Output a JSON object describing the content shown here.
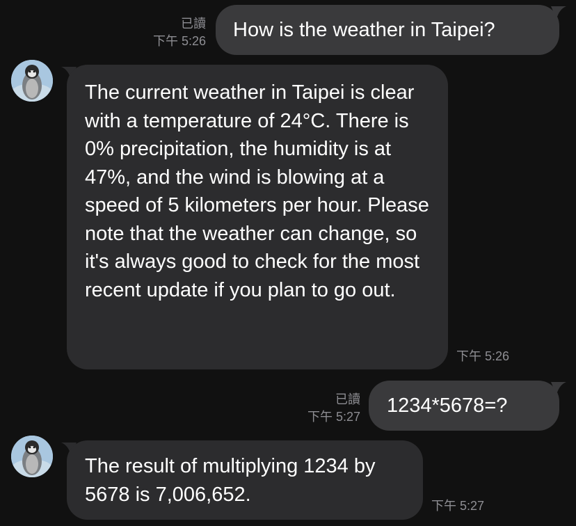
{
  "messages": [
    {
      "direction": "outgoing",
      "text": "How is the weather in Taipei?",
      "read_status": "已讀",
      "time": "下午 5:26"
    },
    {
      "direction": "incoming",
      "text": "The current weather in Taipei is clear with a temperature of 24°C. There is 0% precipitation, the humidity is at 47%, and the wind is blowing at a speed of 5 kilometers per hour. Please note that the weather can change, so it's always good to check for the most recent update if you plan to go out.",
      "time": "下午 5:26",
      "avatar_icon": "penguin-avatar"
    },
    {
      "direction": "outgoing",
      "text": "1234*5678=?",
      "read_status": "已讀",
      "time": "下午 5:27"
    },
    {
      "direction": "incoming",
      "text": "The result of multiplying 1234 by 5678 is 7,006,652.",
      "time": "下午 5:27",
      "avatar_icon": "penguin-avatar"
    }
  ],
  "colors": {
    "background": "#111111",
    "incoming_bubble": "#2c2c2e",
    "outgoing_bubble": "#3a3a3c",
    "meta_text": "#8e8e93",
    "message_text": "#ffffff"
  }
}
